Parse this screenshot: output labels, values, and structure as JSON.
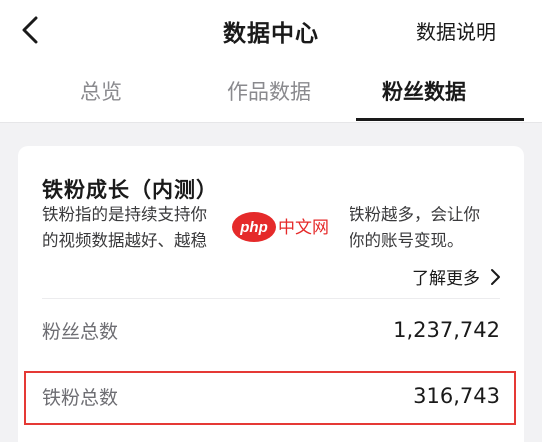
{
  "header": {
    "title": "数据中心",
    "explain_label": "数据说明"
  },
  "tabs": [
    {
      "label": "总览"
    },
    {
      "label": "作品数据"
    },
    {
      "label": "粉丝数据"
    }
  ],
  "card": {
    "title": "铁粉成长（内测）",
    "description_line1": "铁粉指的是持续支持你",
    "description_line1_tail": "铁粉越多，会让你",
    "description_line2": "的视频数据越好、越稳",
    "description_line2_tail": "你的账号变现。",
    "learn_more_label": "了解更多",
    "stats": [
      {
        "label": "粉丝总数",
        "value": "1,237,742"
      },
      {
        "label": "铁粉总数",
        "value": "316,743"
      }
    ]
  },
  "watermark": {
    "text": "php中文网"
  },
  "colors": {
    "accent": "#1a1a1a",
    "highlight": "#e53935",
    "watermark_red": "#e52a2a"
  }
}
